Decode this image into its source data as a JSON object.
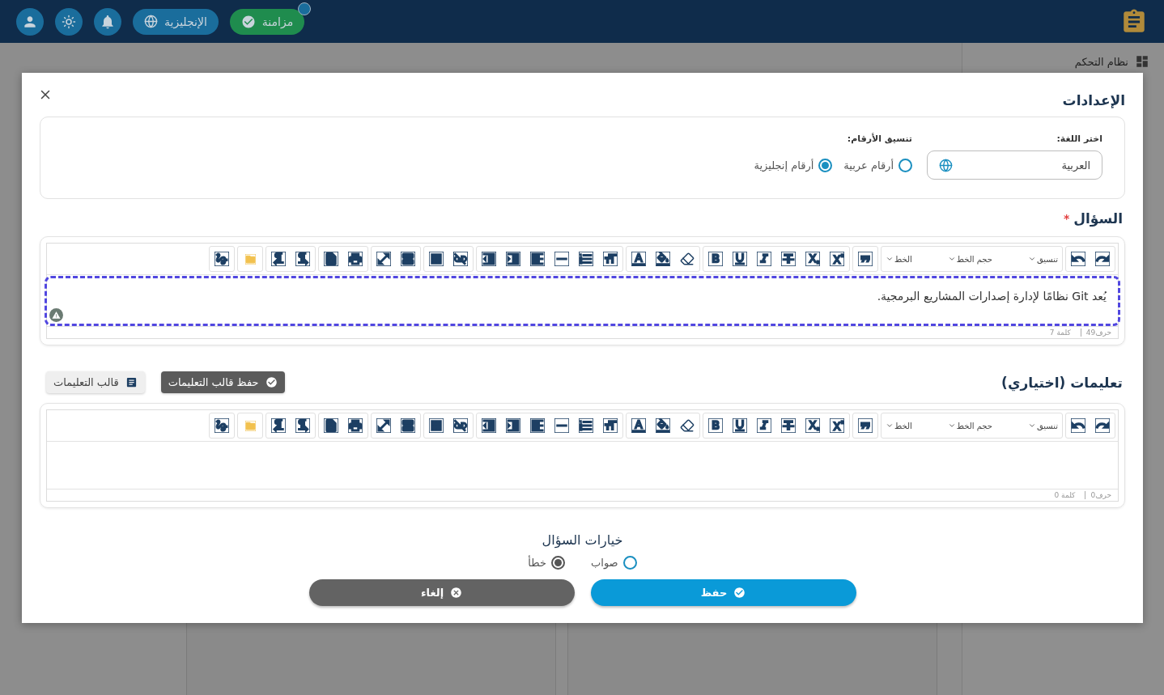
{
  "header": {
    "sync_button": "مزامنة",
    "sync_badge": true,
    "language_button": "الإنجليزية"
  },
  "sidebar": {
    "items": [
      {
        "label": "نظام التحكم"
      }
    ]
  },
  "dialog": {
    "settings": {
      "title": "الإعدادات",
      "language_label": "اختر اللغة:",
      "language_value": "العربية",
      "number_format_label": "تنسيق الأرقام:",
      "number_options": [
        {
          "label": "أرقام عربية",
          "selected": false
        },
        {
          "label": "أرقام إنجليزية",
          "selected": true
        }
      ]
    },
    "question": {
      "title": "السؤال",
      "required": true,
      "required_mark": "*",
      "editor": {
        "format": "تنسيق",
        "size": "حجم الخط",
        "font": "الخط",
        "content": "يُعد Git نظامًا لإدارة إصدارات المشاريع البرمجية.",
        "focused": true,
        "char_count": "حرف49",
        "word_count": "كلمة 7"
      }
    },
    "instructions": {
      "title": "تعليمات (اختياري)",
      "buttons": [
        {
          "label": "حفظ قالب التعليمات",
          "kind": "dark"
        },
        {
          "label": "قالب التعليمات",
          "kind": "light"
        }
      ],
      "editor": {
        "format": "تنسيق",
        "size": "حجم الخط",
        "font": "الخط",
        "char_count": "حرف0",
        "word_count": "كلمة 0"
      }
    },
    "options": {
      "title": "خيارات السؤال",
      "choices": [
        {
          "label": "صواب",
          "selected": false
        },
        {
          "label": "خطأ",
          "selected": true
        }
      ]
    },
    "buttons": [
      {
        "label": "حفظ",
        "kind": "primary"
      },
      {
        "label": "إلغاء",
        "kind": "secondary"
      }
    ]
  }
}
